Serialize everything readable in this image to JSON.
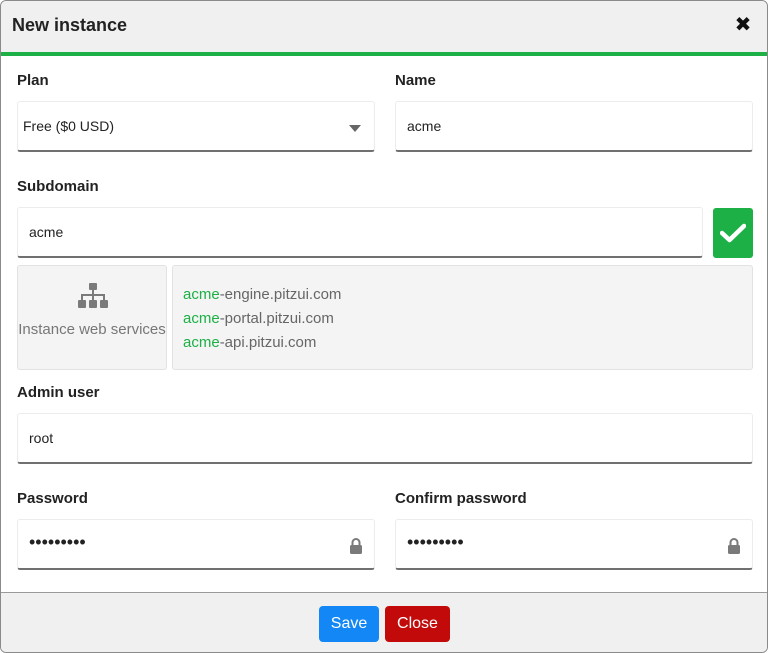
{
  "dialog": {
    "title": "New instance",
    "close_icon": "close-icon"
  },
  "plan": {
    "label": "Plan",
    "value": "Free ($0 USD)"
  },
  "name": {
    "label": "Name",
    "value": "acme"
  },
  "subdomain": {
    "label": "Subdomain",
    "value": "acme",
    "status_icon": "check-icon",
    "status_color": "#1db046"
  },
  "services": {
    "icon": "sitemap-icon",
    "label": "Instance web services",
    "urls": [
      {
        "prefix": "acme",
        "suffix": "-engine.pitzui.com"
      },
      {
        "prefix": "acme",
        "suffix": "-portal.pitzui.com"
      },
      {
        "prefix": "acme",
        "suffix": "-api.pitzui.com"
      }
    ],
    "highlight_color": "#1db046"
  },
  "admin_user": {
    "label": "Admin user",
    "value": "root"
  },
  "password": {
    "label": "Password",
    "value": "•••••••••",
    "icon": "lock-icon"
  },
  "confirm_password": {
    "label": "Confirm password",
    "value": "•••••••••",
    "icon": "lock-icon"
  },
  "footer": {
    "save_label": "Save",
    "close_label": "Close",
    "save_color": "#1287f5",
    "close_color": "#c20a0a"
  }
}
